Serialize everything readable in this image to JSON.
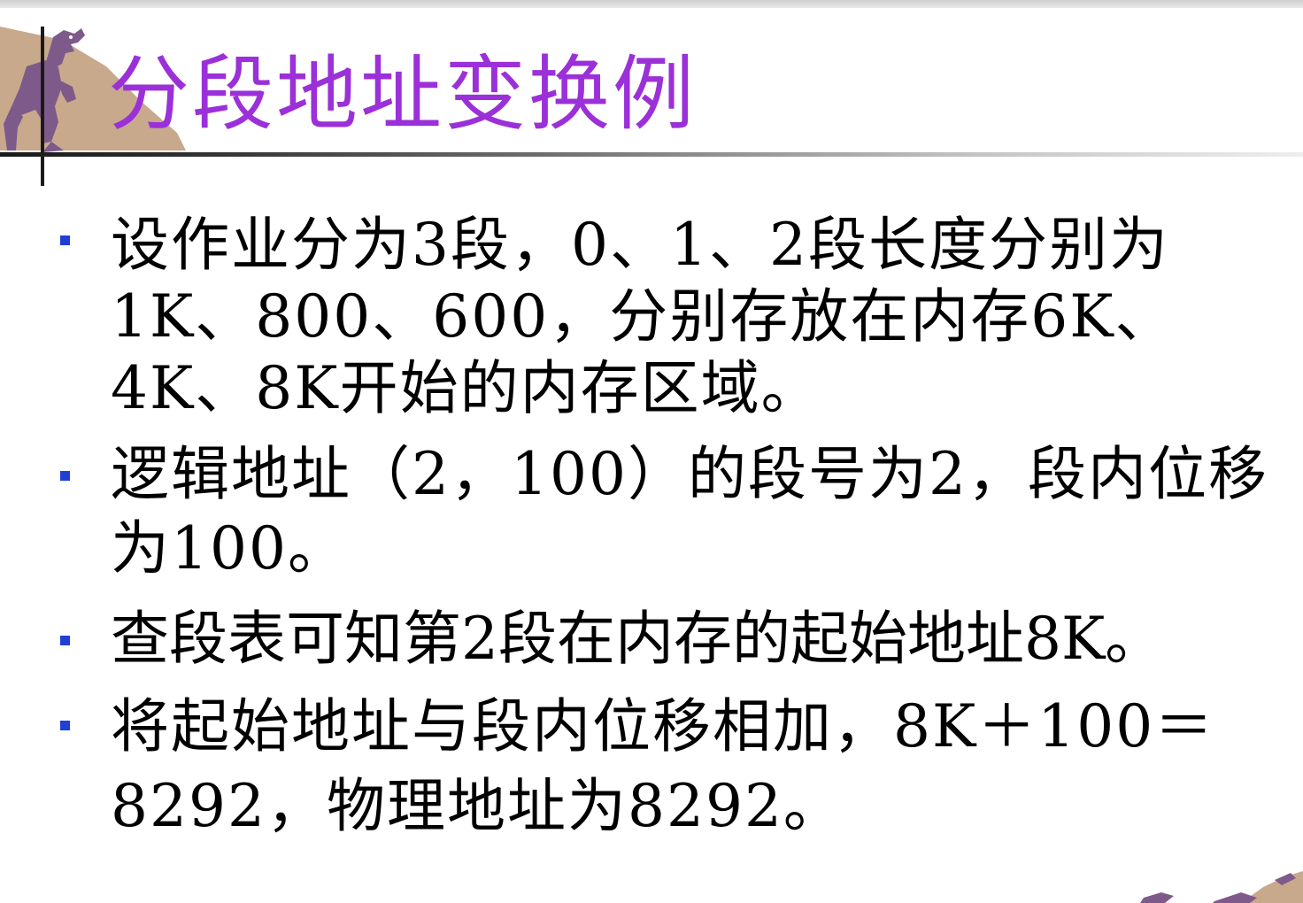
{
  "slide": {
    "title": "分段地址变换例",
    "bullets": [
      {
        "text": "设作业分为3段，0、1、2段长度分别为1K、800、600，分别存放在内存6K、4K、8K开始的内存区域。"
      },
      {
        "text": "逻辑地址（2，100）的段号为2，段内位移为100。"
      },
      {
        "text": "查段表可知第2段在内存的起始地址8K。"
      },
      {
        "text": "将起始地址与段内位移相加，8K＋100＝8292，物理地址为8292。"
      }
    ]
  },
  "colors": {
    "title": "#9b30d9",
    "bullet_marker": "#1f3fd6",
    "body_text": "#000000",
    "rule": "#1a1a1a",
    "art_tan": "#c8a98c",
    "art_purple": "#7e5a8a"
  },
  "icons": {
    "corner_decoration": "dinosaur-illustration",
    "bottom_decoration": "dinosaur-illustration-fragment",
    "bullet": "square-bullet"
  }
}
